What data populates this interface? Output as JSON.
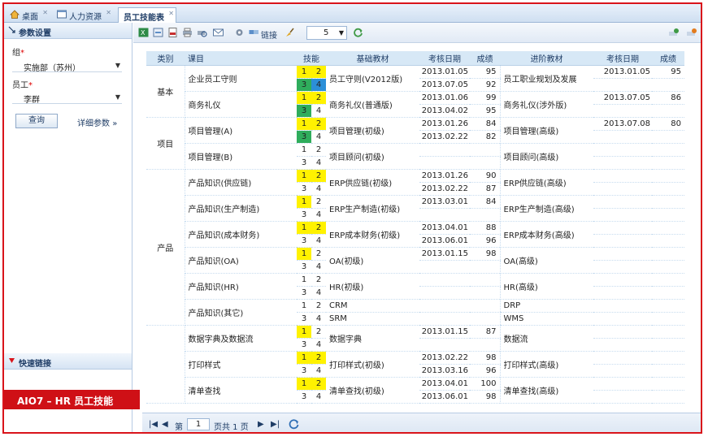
{
  "tabs": [
    {
      "label": "桌面",
      "icon": "home-icon"
    },
    {
      "label": "人力资源",
      "icon": "window-icon"
    },
    {
      "label": "员工技能表",
      "icon": ""
    }
  ],
  "left_panel": {
    "title": "参数设置",
    "group_label": "组",
    "group_value": "实施部（苏州）",
    "employee_label": "员工",
    "employee_value": "李群",
    "required_mark": "*",
    "query_button": "查询",
    "detail_link": "详细参数",
    "detail_arrow": "»",
    "quick_links_title": "快速链接"
  },
  "brand": "AIO7 – HR 员工技能",
  "toolbar": {
    "link_label": "链接",
    "page_size": "5",
    "icons": [
      "excel-icon",
      "export-icon",
      "pdf-icon",
      "print-icon",
      "print-preview-icon",
      "email-icon",
      "settings-icon",
      "link-icon",
      "brush-icon",
      "refresh-icon",
      "add-row-icon",
      "delete-row-icon"
    ]
  },
  "grid": {
    "headers": {
      "category": "类别",
      "course": "课目",
      "skill": "技能",
      "basic_material": "基础教材",
      "exam_date": "考核日期",
      "score": "成绩",
      "advanced_material": "进阶教材",
      "exam_date2": "考核日期",
      "score2": "成绩"
    },
    "categories": [
      "基本",
      "项目",
      "产品"
    ],
    "rows": [
      {
        "course": "企业员工守则",
        "basic": "员工守则(V2012版)",
        "dates": [
          "2013.01.05",
          "2013.07.05"
        ],
        "scores": [
          "95",
          "92"
        ],
        "adv": "员工职业规划及发展",
        "adv_date": "2013.01.05",
        "adv_score": "95"
      },
      {
        "course": "商务礼仪",
        "basic": "商务礼仪(普通版)",
        "dates": [
          "2013.01.06",
          "2013.04.02"
        ],
        "scores": [
          "99",
          "95"
        ],
        "adv": "商务礼仪(涉外版)",
        "adv_date": "2013.07.05",
        "adv_score": "86"
      },
      {
        "course": "项目管理(A)",
        "basic": "项目管理(初级)",
        "dates": [
          "2013.01.26",
          "2013.02.22"
        ],
        "scores": [
          "84",
          "82"
        ],
        "adv": "项目管理(高级)",
        "adv_date": "2013.07.08",
        "adv_score": "80"
      },
      {
        "course": "项目管理(B)",
        "basic": "项目顾问(初级)",
        "dates": [
          "",
          ""
        ],
        "scores": [
          "",
          ""
        ],
        "adv": "项目顾问(高级)",
        "adv_date": "",
        "adv_score": ""
      },
      {
        "course": "产品知识(供应链)",
        "basic": "ERP供应链(初级)",
        "dates": [
          "2013.01.26",
          "2013.02.22"
        ],
        "scores": [
          "90",
          "87"
        ],
        "adv": "ERP供应链(高级)",
        "adv_date": "",
        "adv_score": ""
      },
      {
        "course": "产品知识(生产制造)",
        "basic": "ERP生产制造(初级)",
        "dates": [
          "2013.03.01",
          ""
        ],
        "scores": [
          "84",
          ""
        ],
        "adv": "ERP生产制造(高级)",
        "adv_date": "",
        "adv_score": ""
      },
      {
        "course": "产品知识(成本财务)",
        "basic": "ERP成本财务(初级)",
        "dates": [
          "2013.04.01",
          "2013.06.01"
        ],
        "scores": [
          "88",
          "96"
        ],
        "adv": "ERP成本财务(高级)",
        "adv_date": "",
        "adv_score": ""
      },
      {
        "course": "产品知识(OA)",
        "basic": "OA(初级)",
        "dates": [
          "2013.01.15",
          ""
        ],
        "scores": [
          "98",
          ""
        ],
        "adv": "OA(高级)",
        "adv_date": "",
        "adv_score": ""
      },
      {
        "course": "产品知识(HR)",
        "basic": "HR(初级)",
        "dates": [
          "",
          ""
        ],
        "scores": [
          "",
          ""
        ],
        "adv": "HR(高级)",
        "adv_date": "",
        "adv_score": ""
      },
      {
        "course": "产品知识(其它)",
        "basic": "",
        "basic_lines": [
          "CRM",
          "SRM"
        ],
        "dates": [
          "",
          ""
        ],
        "scores": [
          "",
          ""
        ],
        "adv": "",
        "adv_lines": [
          "DRP",
          "WMS"
        ],
        "adv_date": "",
        "adv_score": ""
      },
      {
        "course": "数据字典及数据流",
        "basic": "数据字典",
        "dates": [
          "2013.01.15",
          ""
        ],
        "scores": [
          "87",
          ""
        ],
        "adv": "数据流",
        "adv_date": "",
        "adv_score": ""
      },
      {
        "course": "打印样式",
        "basic": "打印样式(初级)",
        "dates": [
          "2013.02.22",
          "2013.03.16"
        ],
        "scores": [
          "98",
          "96"
        ],
        "adv": "打印样式(高级)",
        "adv_date": "",
        "adv_score": ""
      },
      {
        "course": "清单查找",
        "basic": "清单查找(初级)",
        "dates": [
          "2013.04.01",
          "2013.06.01"
        ],
        "scores": [
          "100",
          "98"
        ],
        "adv": "清单查找(高级)",
        "adv_date": "",
        "adv_score": ""
      }
    ],
    "skill_digits": [
      "1",
      "2",
      "3",
      "4"
    ],
    "skill_colors": {
      "yellow": "#fff200",
      "green": "#2fad5c",
      "blue": "#2b8fd8"
    }
  },
  "pager": {
    "page_label": "第",
    "page_value": "1",
    "total_label": "页共 1 页"
  }
}
